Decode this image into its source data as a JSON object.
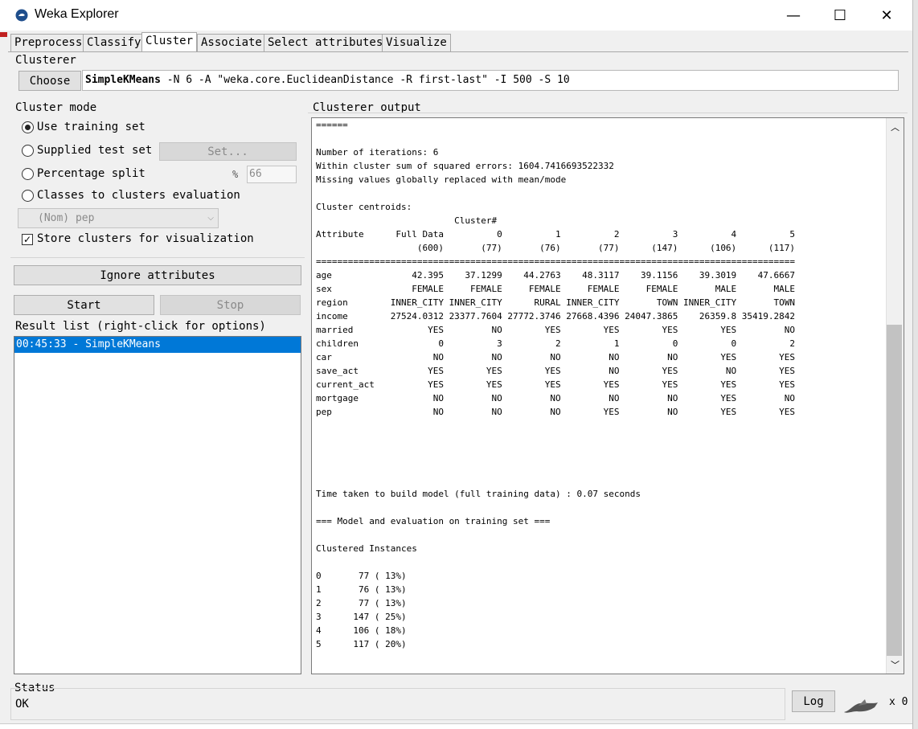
{
  "window": {
    "title": "Weka Explorer",
    "minimize": "—",
    "maximize": "☐",
    "close": "✕"
  },
  "tabs": [
    "Preprocess",
    "Classify",
    "Cluster",
    "Associate",
    "Select attributes",
    "Visualize"
  ],
  "active_tab": "Cluster",
  "clusterer": {
    "group_label": "Clusterer",
    "choose_label": "Choose",
    "algorithm": "SimpleKMeans",
    "options": " -N 6 -A \"weka.core.EuclideanDistance -R first-last\" -I 500 -S 10"
  },
  "cluster_mode": {
    "group_label": "Cluster mode",
    "use_training_set": "Use training set",
    "supplied_test_set": "Supplied test set",
    "set_button": "Set...",
    "percentage_split": "Percentage split",
    "percent_sign": "%",
    "percent_value": "66",
    "classes_to_clusters": "Classes to clusters evaluation",
    "class_select": "(Nom) pep",
    "store_clusters": "Store clusters for visualization",
    "selected_mode": "use_training_set",
    "store_clusters_checked": true
  },
  "ignore_attributes_label": "Ignore attributes",
  "start_label": "Start",
  "stop_label": "Stop",
  "result_list": {
    "label": "Result list (right-click for options)",
    "items": [
      "00:45:33 - SimpleKMeans"
    ]
  },
  "output": {
    "label": "Clusterer output",
    "lines": [
      "======",
      "",
      "Number of iterations: 6",
      "Within cluster sum of squared errors: 1604.7416693522332",
      "Missing values globally replaced with mean/mode",
      "",
      "Cluster centroids:",
      "                          Cluster#",
      "Attribute      Full Data          0          1          2          3          4          5",
      "                   (600)       (77)       (76)       (77)      (147)      (106)      (117)",
      "==========================================================================================",
      "age               42.395    37.1299    44.2763    48.3117    39.1156    39.3019    47.6667",
      "sex               FEMALE     FEMALE     FEMALE     FEMALE     FEMALE       MALE       MALE",
      "region        INNER_CITY INNER_CITY      RURAL INNER_CITY       TOWN INNER_CITY       TOWN",
      "income        27524.0312 23377.7604 27772.3746 27668.4396 24047.3865    26359.8 35419.2842",
      "married              YES         NO        YES        YES        YES        YES         NO",
      "children               0          3          2          1          0          0          2",
      "car                   NO         NO         NO         NO         NO        YES        YES",
      "save_act             YES        YES        YES         NO        YES         NO        YES",
      "current_act          YES        YES        YES        YES        YES        YES        YES",
      "mortgage              NO         NO         NO         NO         NO        YES         NO",
      "pep                   NO         NO         NO        YES         NO        YES        YES",
      "",
      "",
      "",
      "",
      "",
      "Time taken to build model (full training data) : 0.07 seconds",
      "",
      "=== Model and evaluation on training set ===",
      "",
      "Clustered Instances",
      "",
      "0       77 ( 13%)",
      "1       76 ( 13%)",
      "2       77 ( 13%)",
      "3      147 ( 25%)",
      "4      106 ( 18%)",
      "5      117 ( 20%)"
    ]
  },
  "status": {
    "label": "Status",
    "text": "OK",
    "log_label": "Log",
    "count": "x 0"
  },
  "colors": {
    "selection": "#0078d7",
    "background": "#f0f0f0"
  },
  "icons": {
    "app": "weka-bird-icon",
    "status": "weka-bird-status-icon"
  }
}
